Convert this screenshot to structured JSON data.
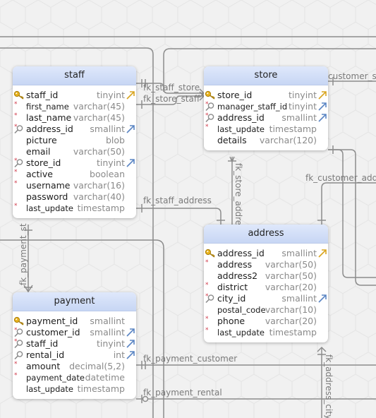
{
  "relations": {
    "customer_store": "customer_st",
    "staff_store": "fk_staff_store",
    "store_staff": "fk_store_staff",
    "customer_address": "fk_customer_add",
    "store_address": "fk_store_addre",
    "staff_address": "fk_staff_address",
    "payment_staff": "fk_payment_st",
    "payment_customer": "fk_payment_customer",
    "payment_rental": "fk_payment_rental",
    "address_city": "fk_address_city"
  },
  "tables": {
    "staff": {
      "name": "staff",
      "columns": [
        {
          "name": "staff_id",
          "type": "tinyint",
          "pk": true,
          "required": false,
          "fk": false,
          "ref": true
        },
        {
          "name": "first_name",
          "type": "varchar(45)",
          "pk": false,
          "required": true,
          "fk": false,
          "ref": false
        },
        {
          "name": "last_name",
          "type": "varchar(45)",
          "pk": false,
          "required": true,
          "fk": false,
          "ref": false
        },
        {
          "name": "address_id",
          "type": "smallint",
          "pk": false,
          "required": true,
          "fk": true,
          "ref": true
        },
        {
          "name": "picture",
          "type": "blob",
          "pk": false,
          "required": false,
          "fk": false,
          "ref": false
        },
        {
          "name": "email",
          "type": "varchar(50)",
          "pk": false,
          "required": false,
          "fk": false,
          "ref": false
        },
        {
          "name": "store_id",
          "type": "tinyint",
          "pk": false,
          "required": true,
          "fk": true,
          "ref": true
        },
        {
          "name": "active",
          "type": "boolean",
          "pk": false,
          "required": true,
          "fk": false,
          "ref": false
        },
        {
          "name": "username",
          "type": "varchar(16)",
          "pk": false,
          "required": true,
          "fk": false,
          "ref": false
        },
        {
          "name": "password",
          "type": "varchar(40)",
          "pk": false,
          "required": false,
          "fk": false,
          "ref": false
        },
        {
          "name": "last_update",
          "type": "timestamp",
          "pk": false,
          "required": true,
          "fk": false,
          "ref": false
        }
      ]
    },
    "store": {
      "name": "store",
      "columns": [
        {
          "name": "store_id",
          "type": "tinyint",
          "pk": true,
          "required": false,
          "fk": false,
          "ref": true
        },
        {
          "name": "manager_staff_id",
          "type": "tinyint",
          "pk": false,
          "required": true,
          "fk": true,
          "ref": true
        },
        {
          "name": "address_id",
          "type": "smallint",
          "pk": false,
          "required": true,
          "fk": true,
          "ref": true
        },
        {
          "name": "last_update",
          "type": "timestamp",
          "pk": false,
          "required": true,
          "fk": false,
          "ref": false
        },
        {
          "name": "details",
          "type": "varchar(120)",
          "pk": false,
          "required": false,
          "fk": false,
          "ref": false
        }
      ]
    },
    "address": {
      "name": "address",
      "columns": [
        {
          "name": "address_id",
          "type": "smallint",
          "pk": true,
          "required": false,
          "fk": false,
          "ref": true
        },
        {
          "name": "address",
          "type": "varchar(50)",
          "pk": false,
          "required": true,
          "fk": false,
          "ref": false
        },
        {
          "name": "address2",
          "type": "varchar(50)",
          "pk": false,
          "required": false,
          "fk": false,
          "ref": false
        },
        {
          "name": "district",
          "type": "varchar(20)",
          "pk": false,
          "required": true,
          "fk": false,
          "ref": false
        },
        {
          "name": "city_id",
          "type": "smallint",
          "pk": false,
          "required": true,
          "fk": true,
          "ref": true
        },
        {
          "name": "postal_code",
          "type": "varchar(10)",
          "pk": false,
          "required": false,
          "fk": false,
          "ref": false
        },
        {
          "name": "phone",
          "type": "varchar(20)",
          "pk": false,
          "required": true,
          "fk": false,
          "ref": false
        },
        {
          "name": "last_update",
          "type": "timestamp",
          "pk": false,
          "required": true,
          "fk": false,
          "ref": false
        }
      ]
    },
    "payment": {
      "name": "payment",
      "columns": [
        {
          "name": "payment_id",
          "type": "smallint",
          "pk": true,
          "required": false,
          "fk": false,
          "ref": false
        },
        {
          "name": "customer_id",
          "type": "smallint",
          "pk": false,
          "required": true,
          "fk": true,
          "ref": true
        },
        {
          "name": "staff_id",
          "type": "tinyint",
          "pk": false,
          "required": true,
          "fk": true,
          "ref": true
        },
        {
          "name": "rental_id",
          "type": "int",
          "pk": false,
          "required": false,
          "fk": true,
          "ref": true
        },
        {
          "name": "amount",
          "type": "decimal(5,2)",
          "pk": false,
          "required": true,
          "fk": false,
          "ref": false
        },
        {
          "name": "payment_date",
          "type": "datetime",
          "pk": false,
          "required": true,
          "fk": false,
          "ref": false
        },
        {
          "name": "last_update",
          "type": "timestamp",
          "pk": false,
          "required": false,
          "fk": false,
          "ref": false
        }
      ]
    }
  }
}
